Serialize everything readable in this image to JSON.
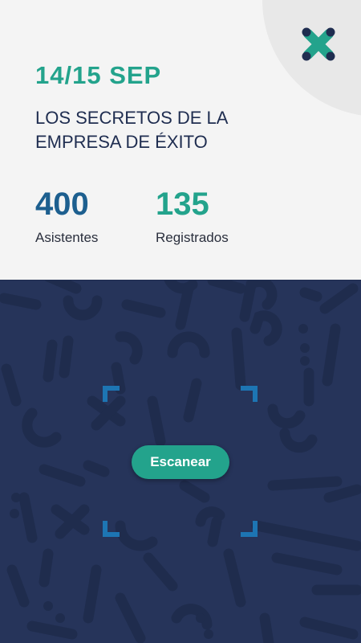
{
  "header": {
    "date": "14/15 SEP",
    "title": "LOS SECRETOS DE LA EMPRESA DE ÉXITO",
    "logo_icon": "x-logo-icon"
  },
  "stats": [
    {
      "value": "400",
      "label": "Asistentes"
    },
    {
      "value": "135",
      "label": "Registrados"
    }
  ],
  "scanner": {
    "button_label": "Escanear",
    "frame_icon": "scan-frame-icon"
  },
  "colors": {
    "accent": "#23a38c",
    "blue": "#1d5f8f",
    "navy": "#26345a",
    "text_dark": "#1f2d50"
  }
}
